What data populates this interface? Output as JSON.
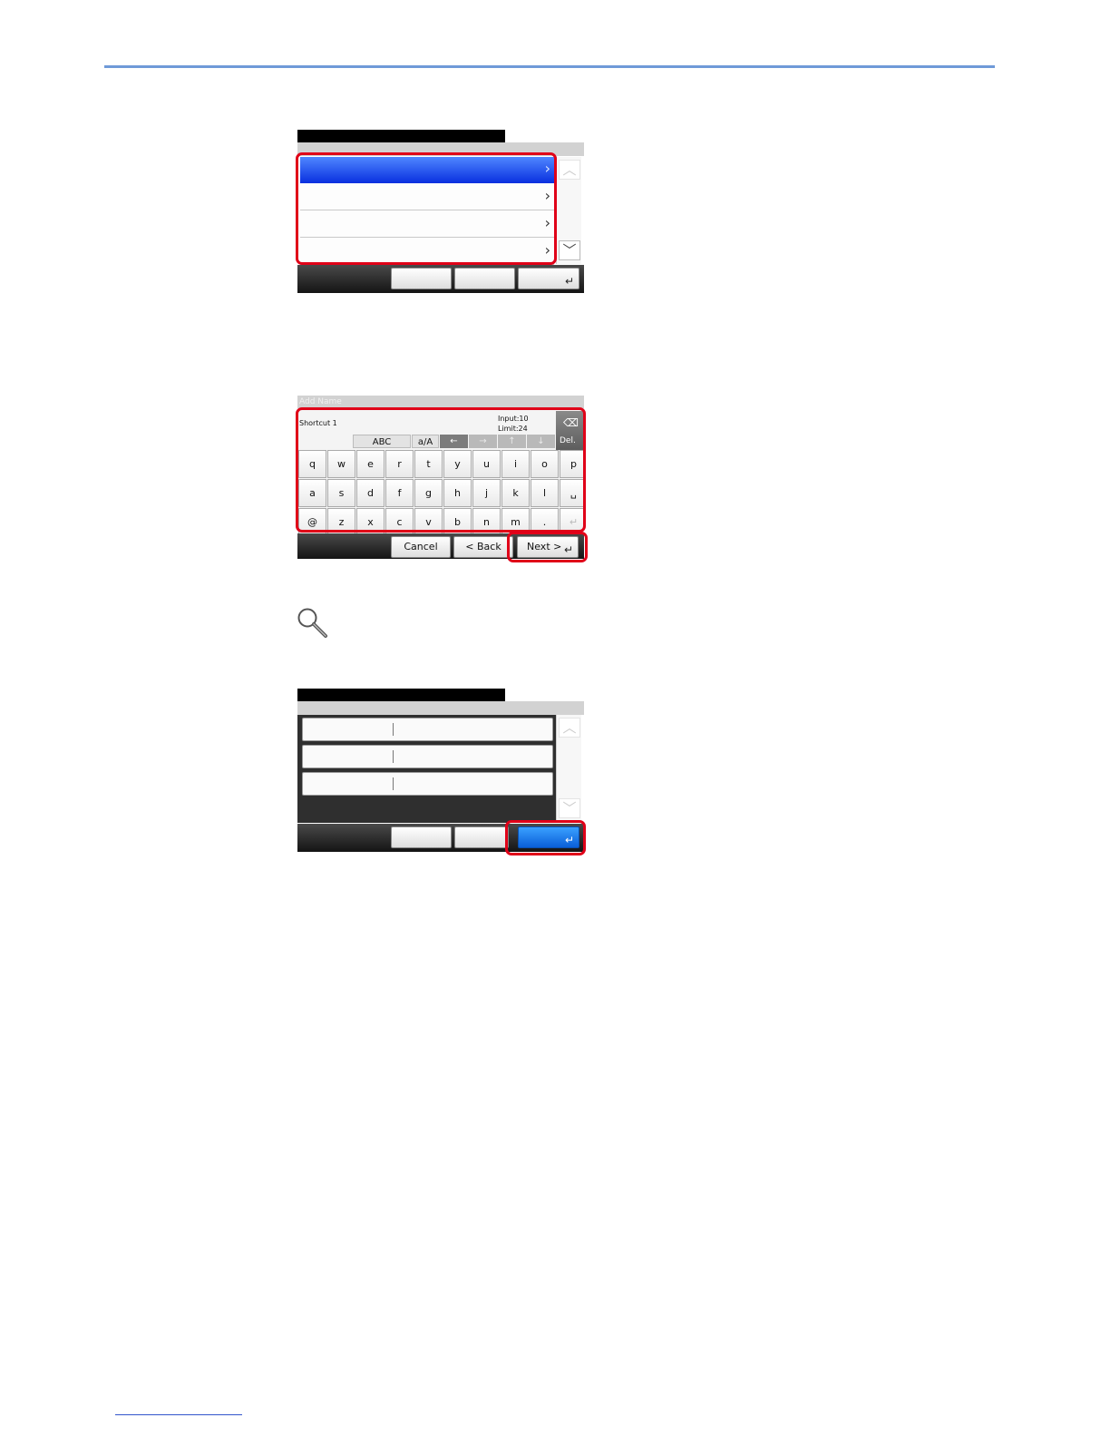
{
  "keyboard_screen": {
    "title": "Add Name",
    "input_text": "Shortcut 1",
    "input_count": "Input:10",
    "input_limit": "Limit:24",
    "delete_label": "Del.",
    "mode_abc": "ABC",
    "mode_case": "a/A",
    "keys_row1": [
      "q",
      "w",
      "e",
      "r",
      "t",
      "y",
      "u",
      "i",
      "o",
      "p"
    ],
    "keys_row2": [
      "a",
      "s",
      "d",
      "f",
      "g",
      "h",
      "j",
      "k",
      "l"
    ],
    "keys_row3": [
      "@",
      "z",
      "x",
      "c",
      "v",
      "b",
      "n",
      "m",
      "."
    ],
    "cancel_label": "Cancel",
    "back_label": "< Back",
    "next_label": "Next >"
  },
  "glyphs": {
    "chevron_right": "›",
    "chevron_up": "︿",
    "chevron_down": "﹀",
    "enter": "↵",
    "arrow_left": "←",
    "arrow_right": "→",
    "arrow_up": "↑",
    "arrow_down": "↓",
    "backspace": "⌫",
    "space": "␣"
  },
  "colors": {
    "rule": "#6f9ad8",
    "highlight_frame": "#e00018",
    "selected_row": "#0b32e0",
    "ok_button": "#0a5fd8"
  }
}
